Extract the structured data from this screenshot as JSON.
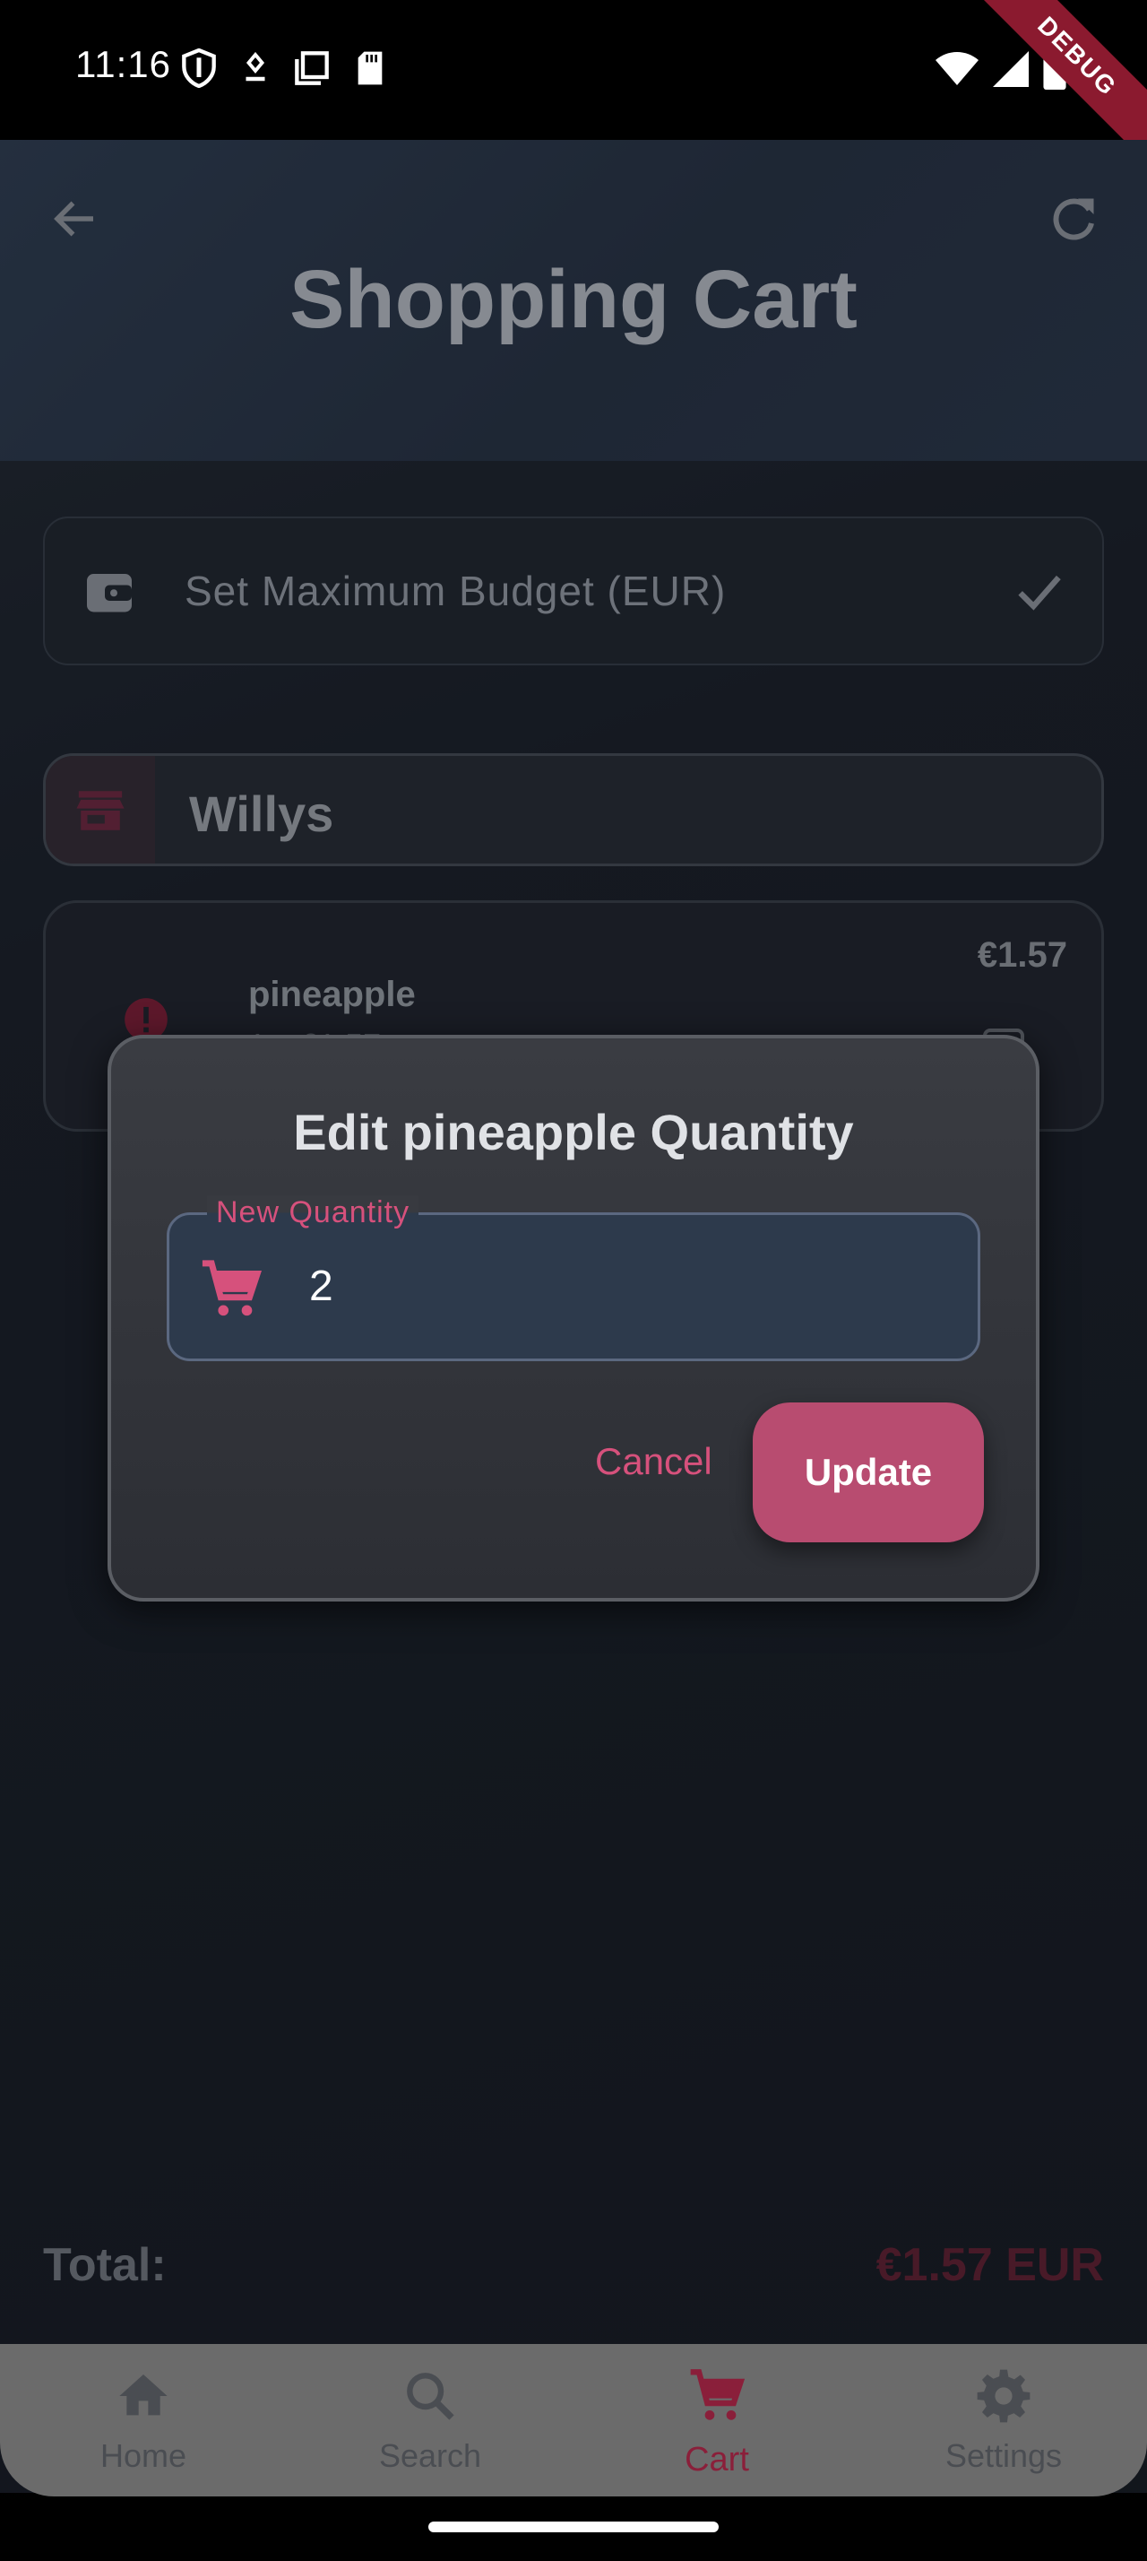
{
  "status_bar": {
    "time": "11:16",
    "debug_label": "DEBUG"
  },
  "header": {
    "title": "Shopping Cart"
  },
  "budget": {
    "placeholder": "Set Maximum Budget (EUR)"
  },
  "store": {
    "name": "Willys"
  },
  "item": {
    "name": "pineapple",
    "price": "€1.57",
    "subtitle": "1 x €1.57"
  },
  "total": {
    "label": "Total:",
    "value": "€1.57 EUR"
  },
  "dialog": {
    "title": "Edit pineapple Quantity",
    "field_label": "New Quantity",
    "field_value": "2",
    "cancel_label": "Cancel",
    "update_label": "Update"
  },
  "nav": {
    "items": [
      {
        "label": "Home",
        "icon": "home-icon"
      },
      {
        "label": "Search",
        "icon": "search-icon"
      },
      {
        "label": "Cart",
        "icon": "cart-icon"
      },
      {
        "label": "Settings",
        "icon": "gear-icon"
      }
    ],
    "active": "Cart"
  },
  "colors": {
    "accent": "#d6517c",
    "update_button": "#b84c70",
    "header": "#2a3648",
    "background": "#1c212a"
  }
}
